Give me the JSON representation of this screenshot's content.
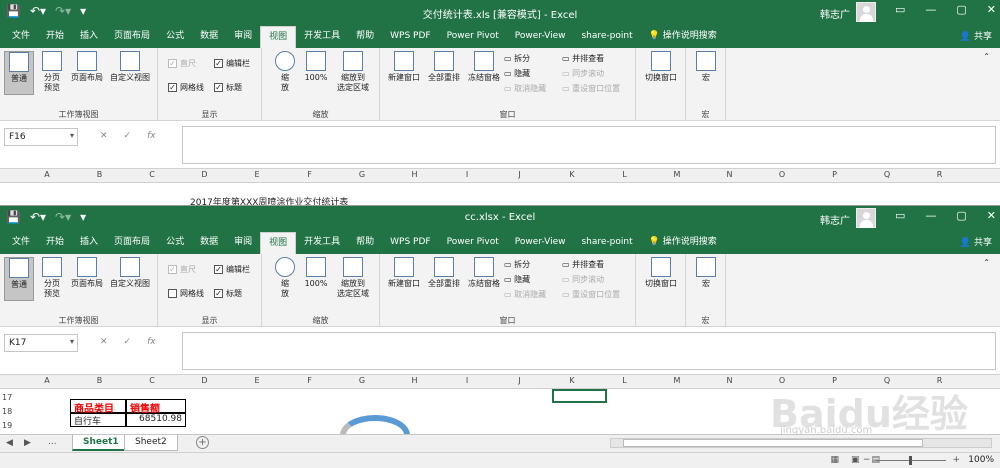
{
  "window1": {
    "title": "交付统计表.xls [兼容模式] - Excel",
    "user": "韩志广",
    "namebox": "F16",
    "partial_text": "2017年度第XXX周喷涂作业交付统计表"
  },
  "window2": {
    "title": "cc.xlsx - Excel",
    "user": "韩志广",
    "namebox": "K17",
    "sheets": [
      "Sheet1",
      "Sheet2"
    ],
    "zoom": "100%",
    "cells": {
      "header1": "商品类目",
      "header2": "销售额",
      "row1_a": "自行车",
      "row1_b": "68510.98"
    }
  },
  "tabs": [
    "文件",
    "开始",
    "插入",
    "页面布局",
    "公式",
    "数据",
    "审阅",
    "视图",
    "开发工具",
    "帮助",
    "WPS PDF",
    "Power Pivot",
    "Power-View",
    "share-point"
  ],
  "tell_me": "操作说明搜索",
  "share": "共享",
  "ribbon": {
    "views": {
      "normal": "普通",
      "pagebreak": "分页\n预览",
      "pagelayout": "页面布局",
      "custom": "自定义视图",
      "label": "工作簿视图"
    },
    "show": {
      "ruler": "直尺",
      "formulabar": "编辑栏",
      "gridlines": "网格线",
      "headings": "标题",
      "label": "显示"
    },
    "zoom": {
      "zoom": "缩\n放",
      "z100": "100%",
      "selection": "缩放到\n选定区域",
      "label": "缩放"
    },
    "window": {
      "newwin": "新建窗口",
      "arrange": "全部重排",
      "freeze": "冻结窗格",
      "split": "拆分",
      "hide": "隐藏",
      "unhide": "取消隐藏",
      "sbs": "并排查看",
      "sync": "同步滚动",
      "reset": "重设窗口位置",
      "switch": "切换窗口",
      "label": "窗口"
    },
    "macros": {
      "macro": "宏",
      "label": "宏"
    }
  },
  "columns": [
    "A",
    "B",
    "C",
    "D",
    "E",
    "F",
    "G",
    "H",
    "I",
    "J",
    "K",
    "L",
    "M",
    "N",
    "O",
    "P",
    "Q",
    "R"
  ],
  "rows2": [
    "17",
    "18",
    "19"
  ],
  "watermark": "Baidu经验",
  "watermark_url": "jingyan.baidu.com"
}
